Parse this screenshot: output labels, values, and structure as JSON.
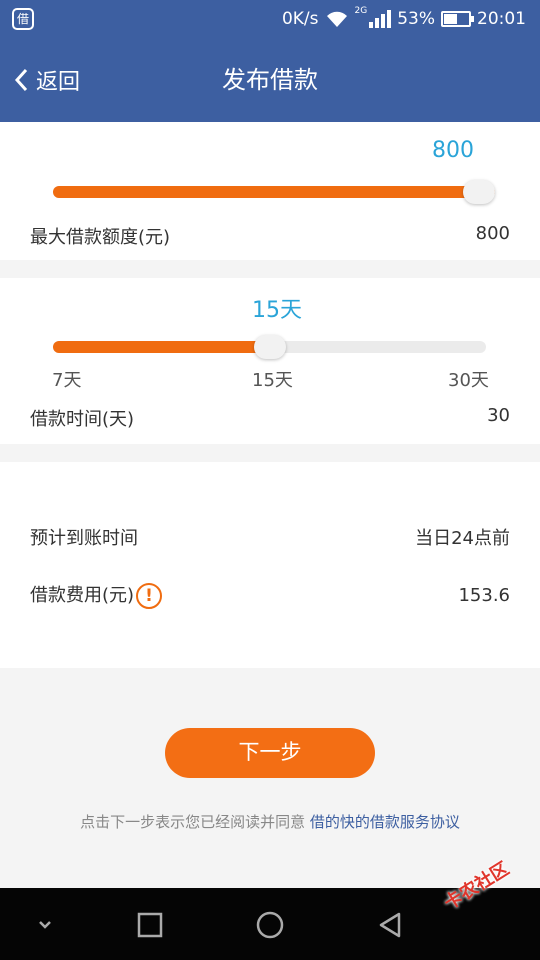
{
  "status_bar": {
    "app_icon_char": "借",
    "net_speed": "0K/s",
    "network_type": "2G",
    "battery": "53%",
    "battery_level": 0.53,
    "time": "20:01"
  },
  "header": {
    "back_label": "返回",
    "title": "发布借款"
  },
  "amount": {
    "current_value": "800",
    "fraction": 1.0,
    "label": "最大借款额度(元)",
    "max_value": "800"
  },
  "term": {
    "current_value": "15天",
    "fraction": 0.5,
    "ticks": [
      "7天",
      "15天",
      "30天"
    ],
    "label": "借款时间(天)",
    "max_value": "30"
  },
  "summary": {
    "arrival_label": "预计到账时间",
    "arrival_value": "当日24点前",
    "fee_label": "借款费用(元)",
    "fee_value": "153.6",
    "fee_info_icon": "!"
  },
  "next_button": "下一步",
  "agreement": {
    "prefix": "点击下一步表示您已经阅读并同意",
    "link": "借的快的借款服务协议"
  },
  "watermark": "卡农社区",
  "colors": {
    "brand": "#3d5fa1",
    "accent": "#f06c10",
    "value_blue": "#2aa4d8"
  }
}
